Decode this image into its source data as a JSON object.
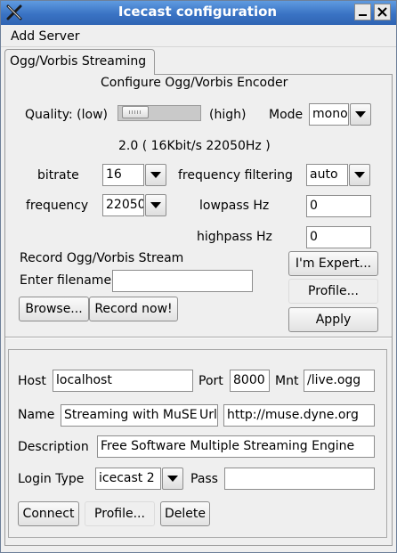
{
  "window": {
    "title": "Icecast configuration",
    "minimize_icon": "minimize-icon",
    "close_icon": "close-icon",
    "app_icon": "x-logo-icon"
  },
  "menu": {
    "add_server": "Add Server"
  },
  "tab": {
    "label": "Ogg/Vorbis Streaming"
  },
  "encoder": {
    "heading": "Configure Ogg/Vorbis Encoder",
    "quality_label": "Quality: (low)",
    "quality_high": "(high)",
    "quality_level": 0.05,
    "mode_label": "Mode",
    "mode_value": "mono",
    "info": "2.0 ( 16Kbit/s 22050Hz )",
    "bitrate_label": "bitrate",
    "bitrate_value": "16",
    "freq_filter_label": "frequency filtering",
    "freq_filter_value": "auto",
    "frequency_label": "frequency",
    "frequency_value": "22050",
    "lowpass_label": "lowpass Hz",
    "lowpass_value": "0",
    "highpass_label": "highpass Hz",
    "highpass_value": "0"
  },
  "record": {
    "heading": "Record Ogg/Vorbis Stream",
    "filename_label": "Enter filename",
    "filename_value": "",
    "browse_btn": "Browse...",
    "record_btn": "Record now!",
    "expert_btn": "I'm Expert...",
    "profile_btn": "Profile...",
    "apply_btn": "Apply"
  },
  "server": {
    "host_label": "Host",
    "host_value": "localhost",
    "port_label": "Port",
    "port_value": "8000",
    "mnt_label": "Mnt",
    "mnt_value": "/live.ogg",
    "name_label": "Name",
    "name_value": "Streaming with MuSE",
    "url_label": "Url",
    "url_value": "http://muse.dyne.org",
    "desc_label": "Description",
    "desc_value": "Free Software Multiple Streaming Engine",
    "login_label": "Login Type",
    "login_value": "icecast 2",
    "pass_label": "Pass",
    "pass_value": "",
    "connect_btn": "Connect",
    "profile_btn": "Profile...",
    "delete_btn": "Delete"
  }
}
